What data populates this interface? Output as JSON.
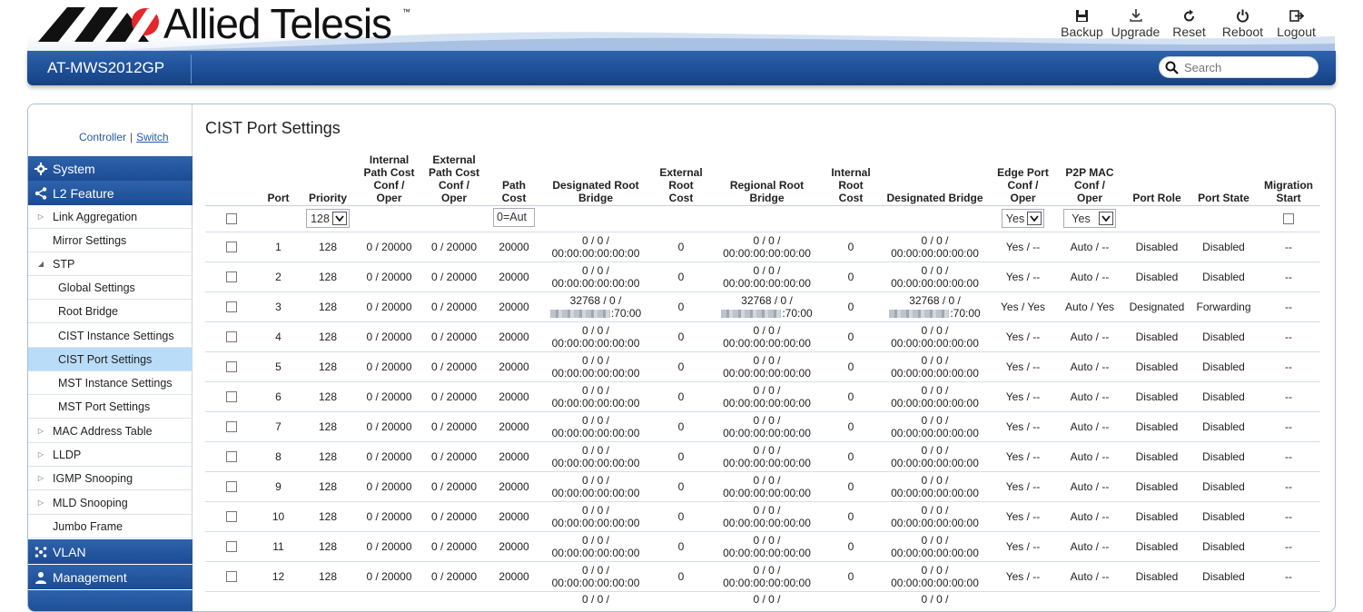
{
  "brand": {
    "name": "Allied Telesis",
    "tm": "™"
  },
  "header_actions": [
    {
      "label": "Backup",
      "icon": "save-icon"
    },
    {
      "label": "Upgrade",
      "icon": "download-icon"
    },
    {
      "label": "Reset",
      "icon": "reset-icon"
    },
    {
      "label": "Reboot",
      "icon": "power-icon"
    },
    {
      "label": "Logout",
      "icon": "logout-icon"
    }
  ],
  "model": "AT-MWS2012GP",
  "search": {
    "placeholder": "Search"
  },
  "sidebar": {
    "controller": "Controller",
    "separator": "|",
    "switch": "Switch",
    "sections": [
      {
        "label": "System",
        "icon": "gear-icon"
      },
      {
        "label": "L2 Feature",
        "icon": "share-icon"
      },
      {
        "label": "VLAN",
        "icon": "network-icon"
      },
      {
        "label": "Management",
        "icon": "user-icon"
      }
    ],
    "items": [
      {
        "label": "Link Aggregation",
        "tri": "▷"
      },
      {
        "label": "Mirror Settings",
        "tri": ""
      },
      {
        "label": "STP",
        "tri": "◢"
      },
      {
        "label": "Global Settings"
      },
      {
        "label": "Root Bridge"
      },
      {
        "label": "CIST Instance Settings"
      },
      {
        "label": "CIST Port Settings"
      },
      {
        "label": "MST Instance Settings"
      },
      {
        "label": "MST Port Settings"
      },
      {
        "label": "MAC Address Table",
        "tri": "▷"
      },
      {
        "label": "LLDP",
        "tri": "▷"
      },
      {
        "label": "IGMP Snooping",
        "tri": "▷"
      },
      {
        "label": "MLD Snooping",
        "tri": "▷"
      },
      {
        "label": "Jumbo Frame",
        "tri": ""
      }
    ]
  },
  "page_title": "CIST Port Settings",
  "table": {
    "headers": {
      "port": "Port",
      "priority": "Priority",
      "internal_path_cost": [
        "Internal",
        "Path Cost",
        "Conf /",
        "Oper"
      ],
      "external_path_cost": [
        "External",
        "Path Cost",
        "Conf /",
        "Oper"
      ],
      "path_cost": [
        "Path",
        "Cost"
      ],
      "designated_root_bridge": [
        "Designated Root",
        "Bridge"
      ],
      "external_root_cost": [
        "External",
        "Root",
        "Cost"
      ],
      "regional_root_bridge": [
        "Regional Root",
        "Bridge"
      ],
      "internal_root_cost": [
        "Internal",
        "Root",
        "Cost"
      ],
      "designated_bridge": "Designated Bridge",
      "edge_port": [
        "Edge Port",
        "Conf /",
        "Oper"
      ],
      "p2p_mac": [
        "P2P MAC",
        "Conf /",
        "Oper"
      ],
      "port_role": "Port Role",
      "port_state": "Port State",
      "migration_start": [
        "Migration",
        "Start"
      ]
    },
    "filter": {
      "priority": "128",
      "path_cost": "0=Aut",
      "edge": "Yes",
      "p2p": "Yes"
    },
    "rows": [
      {
        "port": "1",
        "priority": "128",
        "ipc": "0 / 20000",
        "epc": "0 / 20000",
        "pc": "20000",
        "drb1": "0 / 0 /",
        "drb2": "00:00:00:00:00:00",
        "erc": "0",
        "rrb1": "0 / 0 /",
        "rrb2": "00:00:00:00:00:00",
        "irc": "0",
        "db1": "0 / 0 /",
        "db2": "00:00:00:00:00:00",
        "edge": "Yes / --",
        "p2p": "Auto / --",
        "role": "Disabled",
        "state": "Disabled",
        "mig": "--"
      },
      {
        "port": "2",
        "priority": "128",
        "ipc": "0 / 20000",
        "epc": "0 / 20000",
        "pc": "20000",
        "drb1": "0 / 0 /",
        "drb2": "00:00:00:00:00:00",
        "erc": "0",
        "rrb1": "0 / 0 /",
        "rrb2": "00:00:00:00:00:00",
        "irc": "0",
        "db1": "0 / 0 /",
        "db2": "00:00:00:00:00:00",
        "edge": "Yes / --",
        "p2p": "Auto / --",
        "role": "Disabled",
        "state": "Disabled",
        "mig": "--"
      },
      {
        "port": "3",
        "priority": "128",
        "ipc": "0 / 20000",
        "epc": "0 / 20000",
        "pc": "20000",
        "drb1": "32768 / 0 /",
        "drb2": ":70:00",
        "erc": "0",
        "rrb1": "32768 / 0 /",
        "rrb2": ":70:00",
        "irc": "0",
        "db1": "32768 / 0 /",
        "db2": ":70:00",
        "edge": "Yes / Yes",
        "p2p": "Auto / Yes",
        "role": "Designated",
        "state": "Forwarding",
        "mig": "--",
        "masked": true
      },
      {
        "port": "4",
        "priority": "128",
        "ipc": "0 / 20000",
        "epc": "0 / 20000",
        "pc": "20000",
        "drb1": "0 / 0 /",
        "drb2": "00:00:00:00:00:00",
        "erc": "0",
        "rrb1": "0 / 0 /",
        "rrb2": "00:00:00:00:00:00",
        "irc": "0",
        "db1": "0 / 0 /",
        "db2": "00:00:00:00:00:00",
        "edge": "Yes / --",
        "p2p": "Auto / --",
        "role": "Disabled",
        "state": "Disabled",
        "mig": "--"
      },
      {
        "port": "5",
        "priority": "128",
        "ipc": "0 / 20000",
        "epc": "0 / 20000",
        "pc": "20000",
        "drb1": "0 / 0 /",
        "drb2": "00:00:00:00:00:00",
        "erc": "0",
        "rrb1": "0 / 0 /",
        "rrb2": "00:00:00:00:00:00",
        "irc": "0",
        "db1": "0 / 0 /",
        "db2": "00:00:00:00:00:00",
        "edge": "Yes / --",
        "p2p": "Auto / --",
        "role": "Disabled",
        "state": "Disabled",
        "mig": "--"
      },
      {
        "port": "6",
        "priority": "128",
        "ipc": "0 / 20000",
        "epc": "0 / 20000",
        "pc": "20000",
        "drb1": "0 / 0 /",
        "drb2": "00:00:00:00:00:00",
        "erc": "0",
        "rrb1": "0 / 0 /",
        "rrb2": "00:00:00:00:00:00",
        "irc": "0",
        "db1": "0 / 0 /",
        "db2": "00:00:00:00:00:00",
        "edge": "Yes / --",
        "p2p": "Auto / --",
        "role": "Disabled",
        "state": "Disabled",
        "mig": "--"
      },
      {
        "port": "7",
        "priority": "128",
        "ipc": "0 / 20000",
        "epc": "0 / 20000",
        "pc": "20000",
        "drb1": "0 / 0 /",
        "drb2": "00:00:00:00:00:00",
        "erc": "0",
        "rrb1": "0 / 0 /",
        "rrb2": "00:00:00:00:00:00",
        "irc": "0",
        "db1": "0 / 0 /",
        "db2": "00:00:00:00:00:00",
        "edge": "Yes / --",
        "p2p": "Auto / --",
        "role": "Disabled",
        "state": "Disabled",
        "mig": "--"
      },
      {
        "port": "8",
        "priority": "128",
        "ipc": "0 / 20000",
        "epc": "0 / 20000",
        "pc": "20000",
        "drb1": "0 / 0 /",
        "drb2": "00:00:00:00:00:00",
        "erc": "0",
        "rrb1": "0 / 0 /",
        "rrb2": "00:00:00:00:00:00",
        "irc": "0",
        "db1": "0 / 0 /",
        "db2": "00:00:00:00:00:00",
        "edge": "Yes / --",
        "p2p": "Auto / --",
        "role": "Disabled",
        "state": "Disabled",
        "mig": "--"
      },
      {
        "port": "9",
        "priority": "128",
        "ipc": "0 / 20000",
        "epc": "0 / 20000",
        "pc": "20000",
        "drb1": "0 / 0 /",
        "drb2": "00:00:00:00:00:00",
        "erc": "0",
        "rrb1": "0 / 0 /",
        "rrb2": "00:00:00:00:00:00",
        "irc": "0",
        "db1": "0 / 0 /",
        "db2": "00:00:00:00:00:00",
        "edge": "Yes / --",
        "p2p": "Auto / --",
        "role": "Disabled",
        "state": "Disabled",
        "mig": "--"
      },
      {
        "port": "10",
        "priority": "128",
        "ipc": "0 / 20000",
        "epc": "0 / 20000",
        "pc": "20000",
        "drb1": "0 / 0 /",
        "drb2": "00:00:00:00:00:00",
        "erc": "0",
        "rrb1": "0 / 0 /",
        "rrb2": "00:00:00:00:00:00",
        "irc": "0",
        "db1": "0 / 0 /",
        "db2": "00:00:00:00:00:00",
        "edge": "Yes / --",
        "p2p": "Auto / --",
        "role": "Disabled",
        "state": "Disabled",
        "mig": "--"
      },
      {
        "port": "11",
        "priority": "128",
        "ipc": "0 / 20000",
        "epc": "0 / 20000",
        "pc": "20000",
        "drb1": "0 / 0 /",
        "drb2": "00:00:00:00:00:00",
        "erc": "0",
        "rrb1": "0 / 0 /",
        "rrb2": "00:00:00:00:00:00",
        "irc": "0",
        "db1": "0 / 0 /",
        "db2": "00:00:00:00:00:00",
        "edge": "Yes / --",
        "p2p": "Auto / --",
        "role": "Disabled",
        "state": "Disabled",
        "mig": "--"
      },
      {
        "port": "12",
        "priority": "128",
        "ipc": "0 / 20000",
        "epc": "0 / 20000",
        "pc": "20000",
        "drb1": "0 / 0 /",
        "drb2": "00:00:00:00:00:00",
        "erc": "0",
        "rrb1": "0 / 0 /",
        "rrb2": "00:00:00:00:00:00",
        "irc": "0",
        "db1": "0 / 0 /",
        "db2": "00:00:00:00:00:00",
        "edge": "Yes / --",
        "p2p": "Auto / --",
        "role": "Disabled",
        "state": "Disabled",
        "mig": "--"
      },
      {
        "port": "",
        "priority": "",
        "ipc": "",
        "epc": "",
        "pc": "",
        "drb1": "0 / 0 /",
        "drb2": "",
        "erc": "",
        "rrb1": "0 / 0 /",
        "rrb2": "",
        "irc": "",
        "db1": "0 / 0 /",
        "db2": "",
        "edge": "",
        "p2p": "",
        "role": "",
        "state": "",
        "mig": "",
        "partial": true
      }
    ]
  },
  "colors": {
    "brand_blue": "#1e4f98",
    "selected_item": "#b9dcf8",
    "link": "#2458a8",
    "logo_red": "#e5262c"
  }
}
